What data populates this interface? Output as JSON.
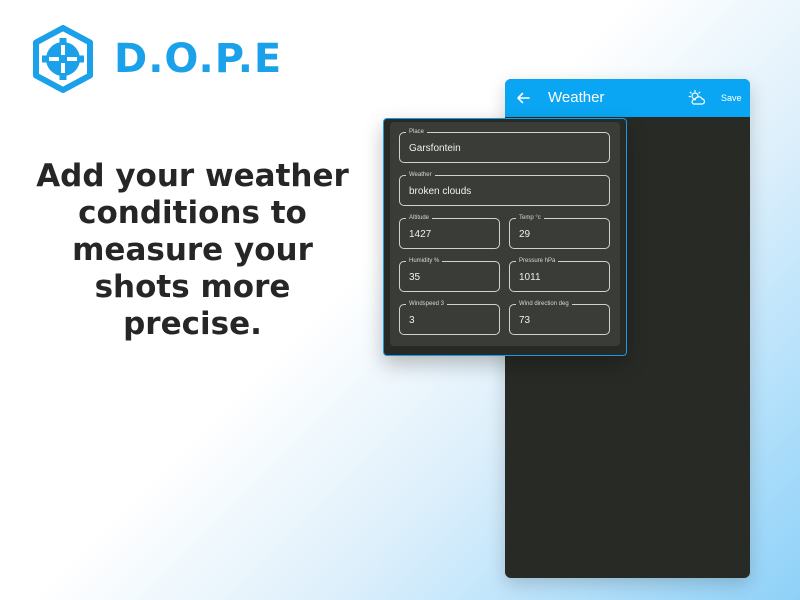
{
  "brand": {
    "name": "D.O.P.E",
    "logo_icon": "dope-logo-icon",
    "color": "#1aa1ea"
  },
  "headline": "Add your weather conditions to measure your shots more precise.",
  "app_bar": {
    "title": "Weather",
    "save_label": "Save",
    "back_icon": "arrow-back-icon",
    "weather_icon": "partly-cloudy-icon",
    "color": "#0aa6f4"
  },
  "form": {
    "place": {
      "label": "Place",
      "value": "Garsfontein"
    },
    "weather": {
      "label": "Weather",
      "value": "broken clouds"
    },
    "altitude": {
      "label": "Altitude",
      "value": "1427"
    },
    "temp": {
      "label": "Temp °c",
      "value": "29"
    },
    "humidity": {
      "label": "Humidity %",
      "value": "35"
    },
    "pressure": {
      "label": "Pressure hPa",
      "value": "1011"
    },
    "windspeed": {
      "label": "Windspeed 3",
      "value": "3"
    },
    "wind_direction": {
      "label": "Wind direction deg",
      "value": "73"
    }
  }
}
